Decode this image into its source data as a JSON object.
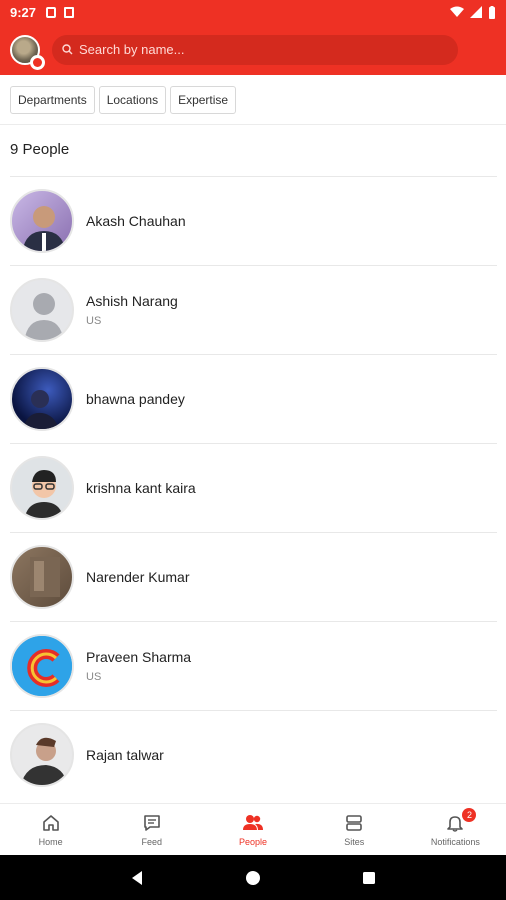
{
  "status": {
    "time": "9:27"
  },
  "search": {
    "placeholder": "Search by name..."
  },
  "filters": [
    "Departments",
    "Locations",
    "Expertise"
  ],
  "people_count": "9 People",
  "people": [
    {
      "name": "Akash Chauhan",
      "location": ""
    },
    {
      "name": "Ashish Narang",
      "location": "US"
    },
    {
      "name": "bhawna pandey",
      "location": ""
    },
    {
      "name": "krishna kant kaira",
      "location": ""
    },
    {
      "name": "Narender Kumar",
      "location": ""
    },
    {
      "name": "Praveen Sharma",
      "location": "US"
    },
    {
      "name": "Rajan talwar",
      "location": ""
    }
  ],
  "nav": {
    "home": "Home",
    "feed": "Feed",
    "people": "People",
    "sites": "Sites",
    "notifications": "Notifications",
    "notifications_badge": "2"
  },
  "colors": {
    "brand": "#ee3124"
  }
}
